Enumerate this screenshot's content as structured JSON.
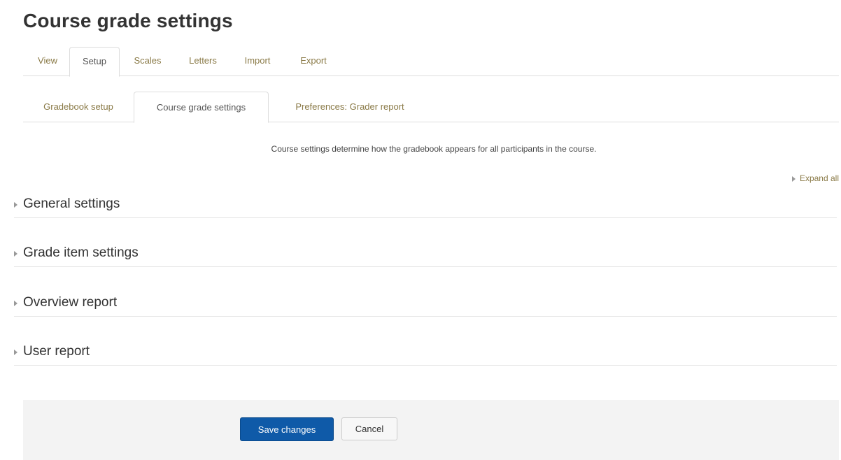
{
  "page_title": "Course grade settings",
  "primary_tabs": [
    {
      "label": "View"
    },
    {
      "label": "Setup"
    },
    {
      "label": "Scales"
    },
    {
      "label": "Letters"
    },
    {
      "label": "Import"
    },
    {
      "label": "Export"
    }
  ],
  "primary_active": "Setup",
  "secondary_tabs": [
    {
      "label": "Gradebook setup"
    },
    {
      "label": "Course grade settings"
    },
    {
      "label": "Preferences: Grader report"
    }
  ],
  "secondary_active": "Course grade settings",
  "intro_text": "Course settings determine how the gradebook appears for all participants in the course.",
  "expand_all_label": "Expand all",
  "sections": [
    {
      "label": "General settings"
    },
    {
      "label": "Grade item settings"
    },
    {
      "label": "Overview report"
    },
    {
      "label": "User report"
    }
  ],
  "buttons": {
    "save": "Save changes",
    "cancel": "Cancel"
  },
  "colors": {
    "link": "#8a7a47",
    "primary_button": "#0f5aa8",
    "footer_bg": "#f3f3f3"
  }
}
